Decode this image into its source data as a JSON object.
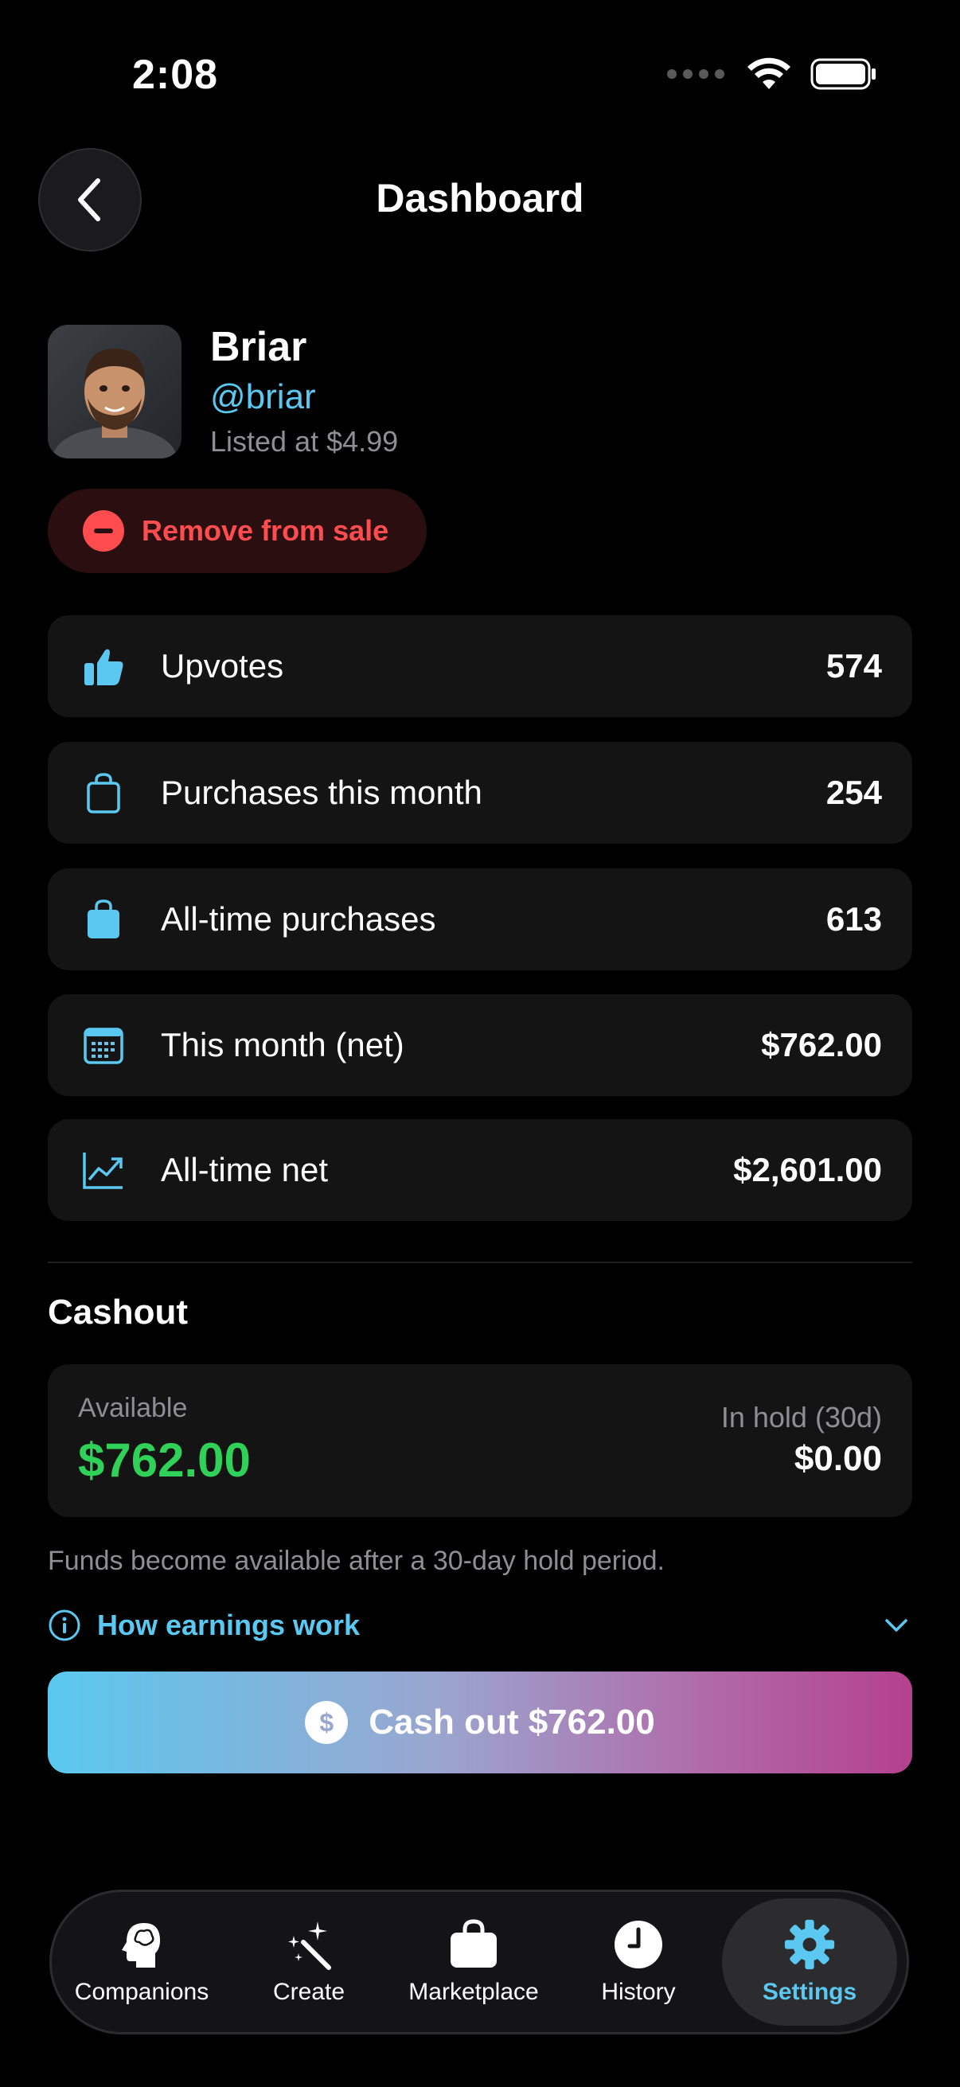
{
  "status_bar": {
    "time": "2:08"
  },
  "header": {
    "title": "Dashboard"
  },
  "profile": {
    "name": "Briar",
    "handle": "@briar",
    "listed_price": "Listed at $4.99"
  },
  "actions": {
    "remove_label": "Remove from sale"
  },
  "stats": [
    {
      "icon": "thumbs-up-icon",
      "label": "Upvotes",
      "value": "574"
    },
    {
      "icon": "bag-outline-icon",
      "label": "Purchases this month",
      "value": "254"
    },
    {
      "icon": "bag-filled-icon",
      "label": "All-time purchases",
      "value": "613"
    },
    {
      "icon": "calendar-icon",
      "label": "This month (net)",
      "value": "$762.00"
    },
    {
      "icon": "trend-chart-icon",
      "label": "All-time net",
      "value": "$2,601.00"
    }
  ],
  "cashout": {
    "section_title": "Cashout",
    "available_label": "Available",
    "available_value": "$762.00",
    "hold_label": "In hold (30d)",
    "hold_value": "$0.00",
    "note": "Funds become available after a 30-day hold period.",
    "earnings_link": "How earnings work",
    "button_label": "Cash out $762.00",
    "button_icon_text": "$"
  },
  "tabs": [
    {
      "label": "Companions",
      "icon": "brain-head-icon",
      "active": false
    },
    {
      "label": "Create",
      "icon": "magic-wand-icon",
      "active": false
    },
    {
      "label": "Marketplace",
      "icon": "shopping-bag-icon",
      "active": false
    },
    {
      "label": "History",
      "icon": "clock-icon",
      "active": false
    },
    {
      "label": "Settings",
      "icon": "gear-icon",
      "active": true
    }
  ],
  "colors": {
    "accent": "#5ac8f0",
    "danger": "#ff4d4f",
    "success": "#30d158",
    "card": "#141414"
  }
}
